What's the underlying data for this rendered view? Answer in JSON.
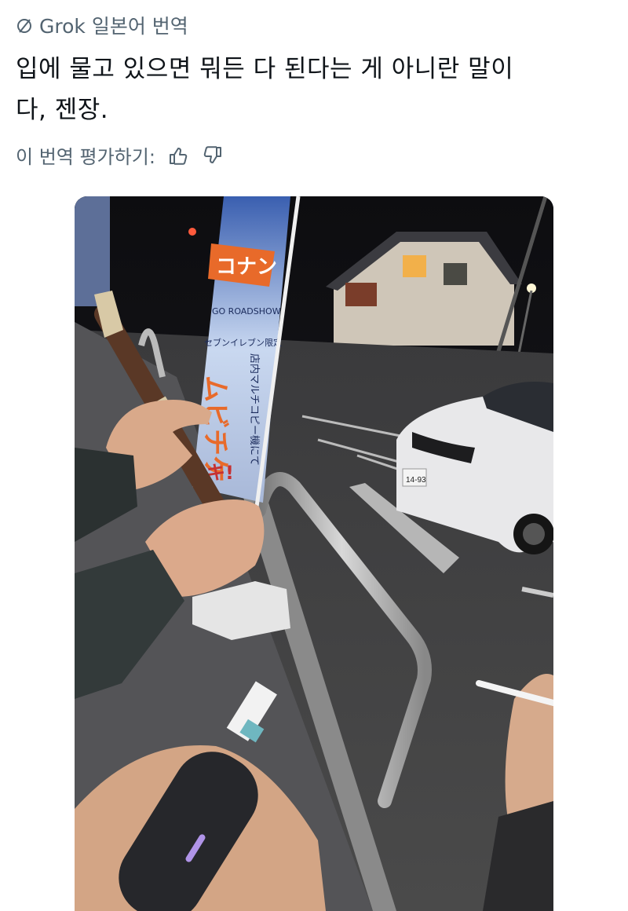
{
  "header": {
    "label": "Grok 일본어 번역",
    "icon": "slash-circle-icon"
  },
  "translation": {
    "line1": "입에 물고 있으면 뭐든 다 된다는 게 아니란 말이",
    "line2": "다, 젠장."
  },
  "rating": {
    "label": "이 번역 평가하기:",
    "like_icon": "thumbs-up-icon",
    "dislike_icon": "thumbs-down-icon"
  },
  "photo": {
    "banner_text_main": "コナン",
    "banner_text_sub": "セブンイレブン限定",
    "banner_text_large": "ムビチケ",
    "banner_text_side": "店内マルチコピー機にて",
    "banner_text_bottom": "キ!",
    "license_plate": "14-93",
    "banner_show": "GO ROADSHOW"
  }
}
